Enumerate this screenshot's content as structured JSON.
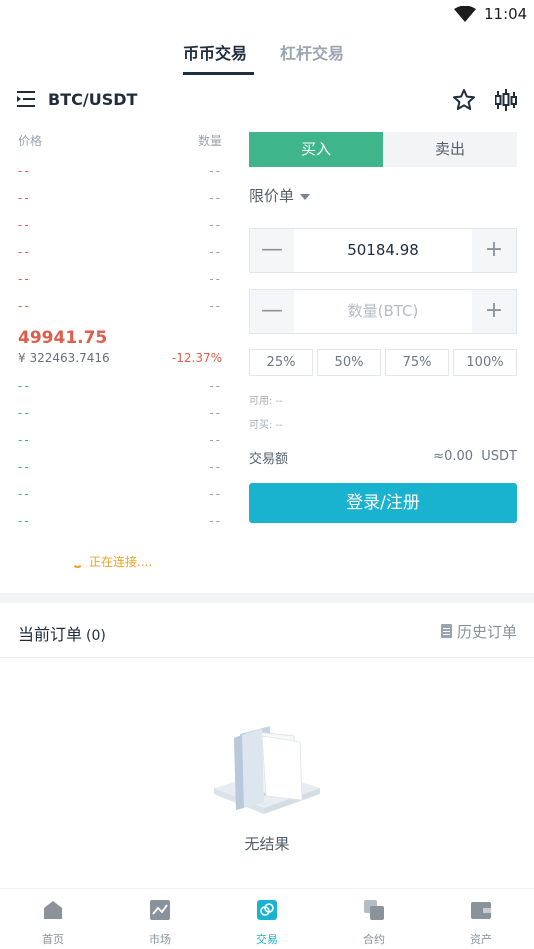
{
  "status_bar": {
    "time": "11:04",
    "wifi_icon": "wifi-icon"
  },
  "mode_tabs": [
    {
      "label": "币币交易",
      "active": true
    },
    {
      "label": "杠杆交易",
      "active": false
    }
  ],
  "pair": {
    "name": "BTC/USDT",
    "menu_icon": "menu-icon",
    "favorite_icon": "star-icon",
    "chart_icon": "candlestick-icon"
  },
  "order_book": {
    "header": {
      "price": "价格",
      "quantity": "数量"
    },
    "asks": [
      {
        "price": "--",
        "qty": "--"
      },
      {
        "price": "--",
        "qty": "--"
      },
      {
        "price": "--",
        "qty": "--"
      },
      {
        "price": "--",
        "qty": "--"
      },
      {
        "price": "--",
        "qty": "--"
      },
      {
        "price": "--",
        "qty": "--"
      }
    ],
    "last_price": "49941.75",
    "cny_price": "¥ 322463.7416",
    "change": "-12.37%",
    "bids": [
      {
        "price": "--",
        "qty": "--"
      },
      {
        "price": "--",
        "qty": "--"
      },
      {
        "price": "--",
        "qty": "--"
      },
      {
        "price": "--",
        "qty": "--"
      },
      {
        "price": "--",
        "qty": "--"
      },
      {
        "price": "--",
        "qty": "--"
      }
    ],
    "connecting": "正在连接...."
  },
  "trade_form": {
    "buy_label": "买入",
    "sell_label": "卖出",
    "order_type": "限价单",
    "price_value": "50184.98",
    "quantity_placeholder": "数量(BTC)",
    "percent_options": [
      "25%",
      "50%",
      "75%",
      "100%"
    ],
    "available": "可用: --",
    "can_buy": "可买: --",
    "amount_label": "交易额",
    "amount_value": "≈0.00",
    "amount_unit": "USDT",
    "login_button": "登录/注册"
  },
  "orders": {
    "title": "当前订单",
    "count": "(0)",
    "history_label": "历史订单",
    "empty_text": "无结果"
  },
  "bottom_nav": [
    {
      "label": "首页",
      "icon": "home-icon",
      "active": false
    },
    {
      "label": "市场",
      "icon": "market-chart-icon",
      "active": false
    },
    {
      "label": "交易",
      "icon": "trade-icon",
      "active": true
    },
    {
      "label": "合约",
      "icon": "contract-icon",
      "active": false
    },
    {
      "label": "资产",
      "icon": "wallet-icon",
      "active": false
    }
  ],
  "colors": {
    "primary": "#1ab3cf",
    "buy_green": "#3fb58b",
    "ask_red": "#e05c4b",
    "bid_green": "#2fb589",
    "warning": "#f0a020"
  }
}
